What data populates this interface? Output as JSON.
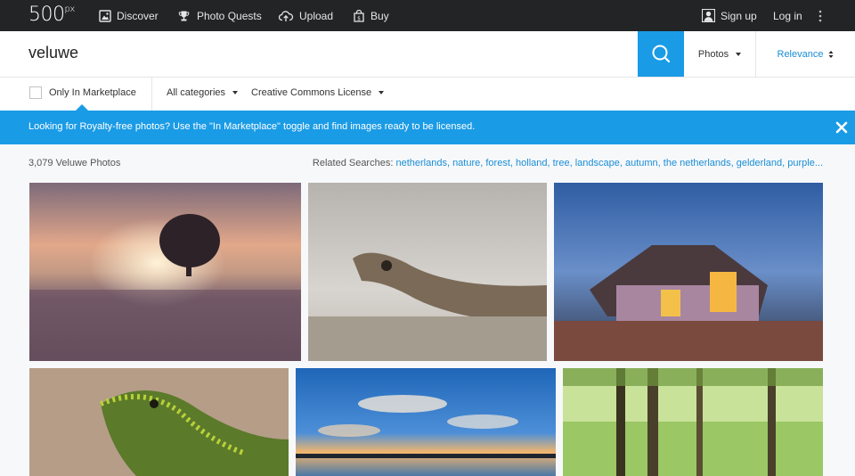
{
  "brand": {
    "logo": "500",
    "logo_sup": "px"
  },
  "nav": {
    "discover": "Discover",
    "photo_quests": "Photo Quests",
    "upload": "Upload",
    "buy": "Buy",
    "sign_up": "Sign up",
    "log_in": "Log in"
  },
  "search": {
    "query": "veluwe",
    "type": "Photos",
    "sort": "Relevance"
  },
  "filters": {
    "marketplace": "Only In Marketplace",
    "categories": "All categories",
    "license": "Creative Commons License"
  },
  "banner": {
    "text": "Looking for Royalty-free photos? Use the \"In Marketplace\" toggle and find images ready to be licensed."
  },
  "results": {
    "count": "3,079 Veluwe Photos",
    "related_label": "Related Searches:",
    "related": [
      "netherlands,",
      "nature,",
      "forest,",
      "holland,",
      "tree,",
      "landscape,",
      "autumn,",
      "the netherlands,",
      "gelderland,",
      "purple..."
    ]
  },
  "colors": {
    "accent": "#1a9be6",
    "topbar": "#222426",
    "link": "#1a8ed6"
  },
  "icons": [
    "discover-icon",
    "trophy-icon",
    "upload-cloud-icon",
    "buy-icon",
    "user-icon",
    "more-vertical-icon",
    "search-icon",
    "close-icon"
  ]
}
